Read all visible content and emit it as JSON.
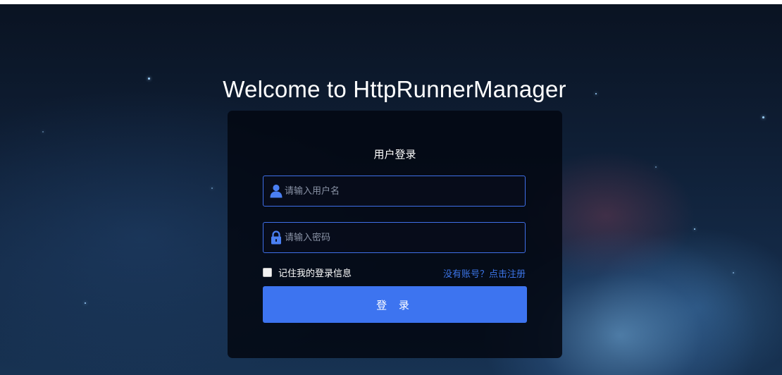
{
  "page": {
    "title": "Welcome to HttpRunnerManager"
  },
  "login_form": {
    "heading": "用户登录",
    "username": {
      "value": "",
      "placeholder": "请输入用户名",
      "icon": "user-icon"
    },
    "password": {
      "value": "",
      "placeholder": "请输入密码",
      "icon": "lock-icon"
    },
    "remember_me": {
      "label": "记住我的登录信息",
      "checked": false
    },
    "register_link": "没有账号？点击注册",
    "submit_label": "登 录"
  },
  "colors": {
    "accent": "#3d74f0",
    "link": "#3b74e6",
    "input_border": "#3f6fe8",
    "card_bg": "#03080f"
  }
}
